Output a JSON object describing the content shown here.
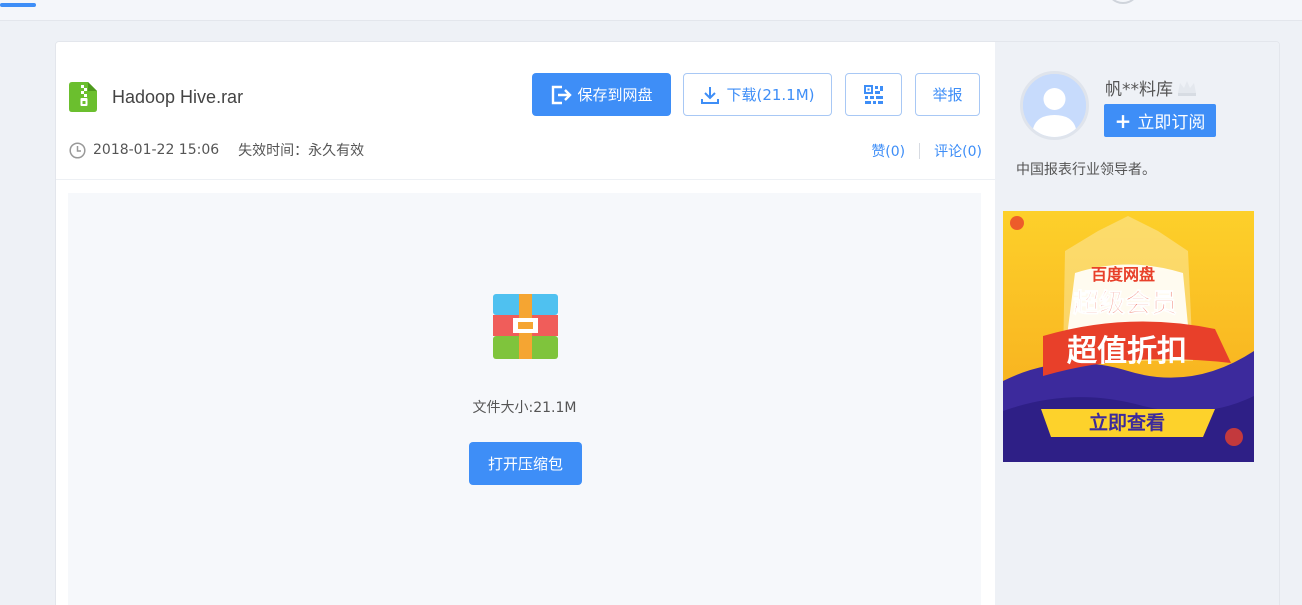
{
  "file": {
    "name": "Hadoop Hive.rar",
    "date": "2018-01-22 15:06",
    "expire": "失效时间：永久有效"
  },
  "toolbar": {
    "save_label": "保存到网盘",
    "download_label": "下载(21.1M)",
    "report_label": "举报",
    "qr_icon": "qr-code-icon"
  },
  "actions": {
    "like": "赞(0)",
    "comment": "评论(0)"
  },
  "preview": {
    "size_text": "文件大小:21.1M",
    "open_label": "打开压缩包"
  },
  "user": {
    "name": "帆**料库",
    "subscribe_label": "立即订阅",
    "description": "中国报表行业领导者。"
  },
  "ad": {
    "line1": "百度网盘",
    "line2": "超级会员",
    "line3": "超值折扣",
    "button": "立即查看"
  },
  "colors": {
    "accent": "#3e8ef7",
    "page_bg": "#eef1f6",
    "ad_yellow": "#fbbf1a",
    "ad_purple": "#3c2a9c",
    "ad_red": "#e8402a"
  }
}
